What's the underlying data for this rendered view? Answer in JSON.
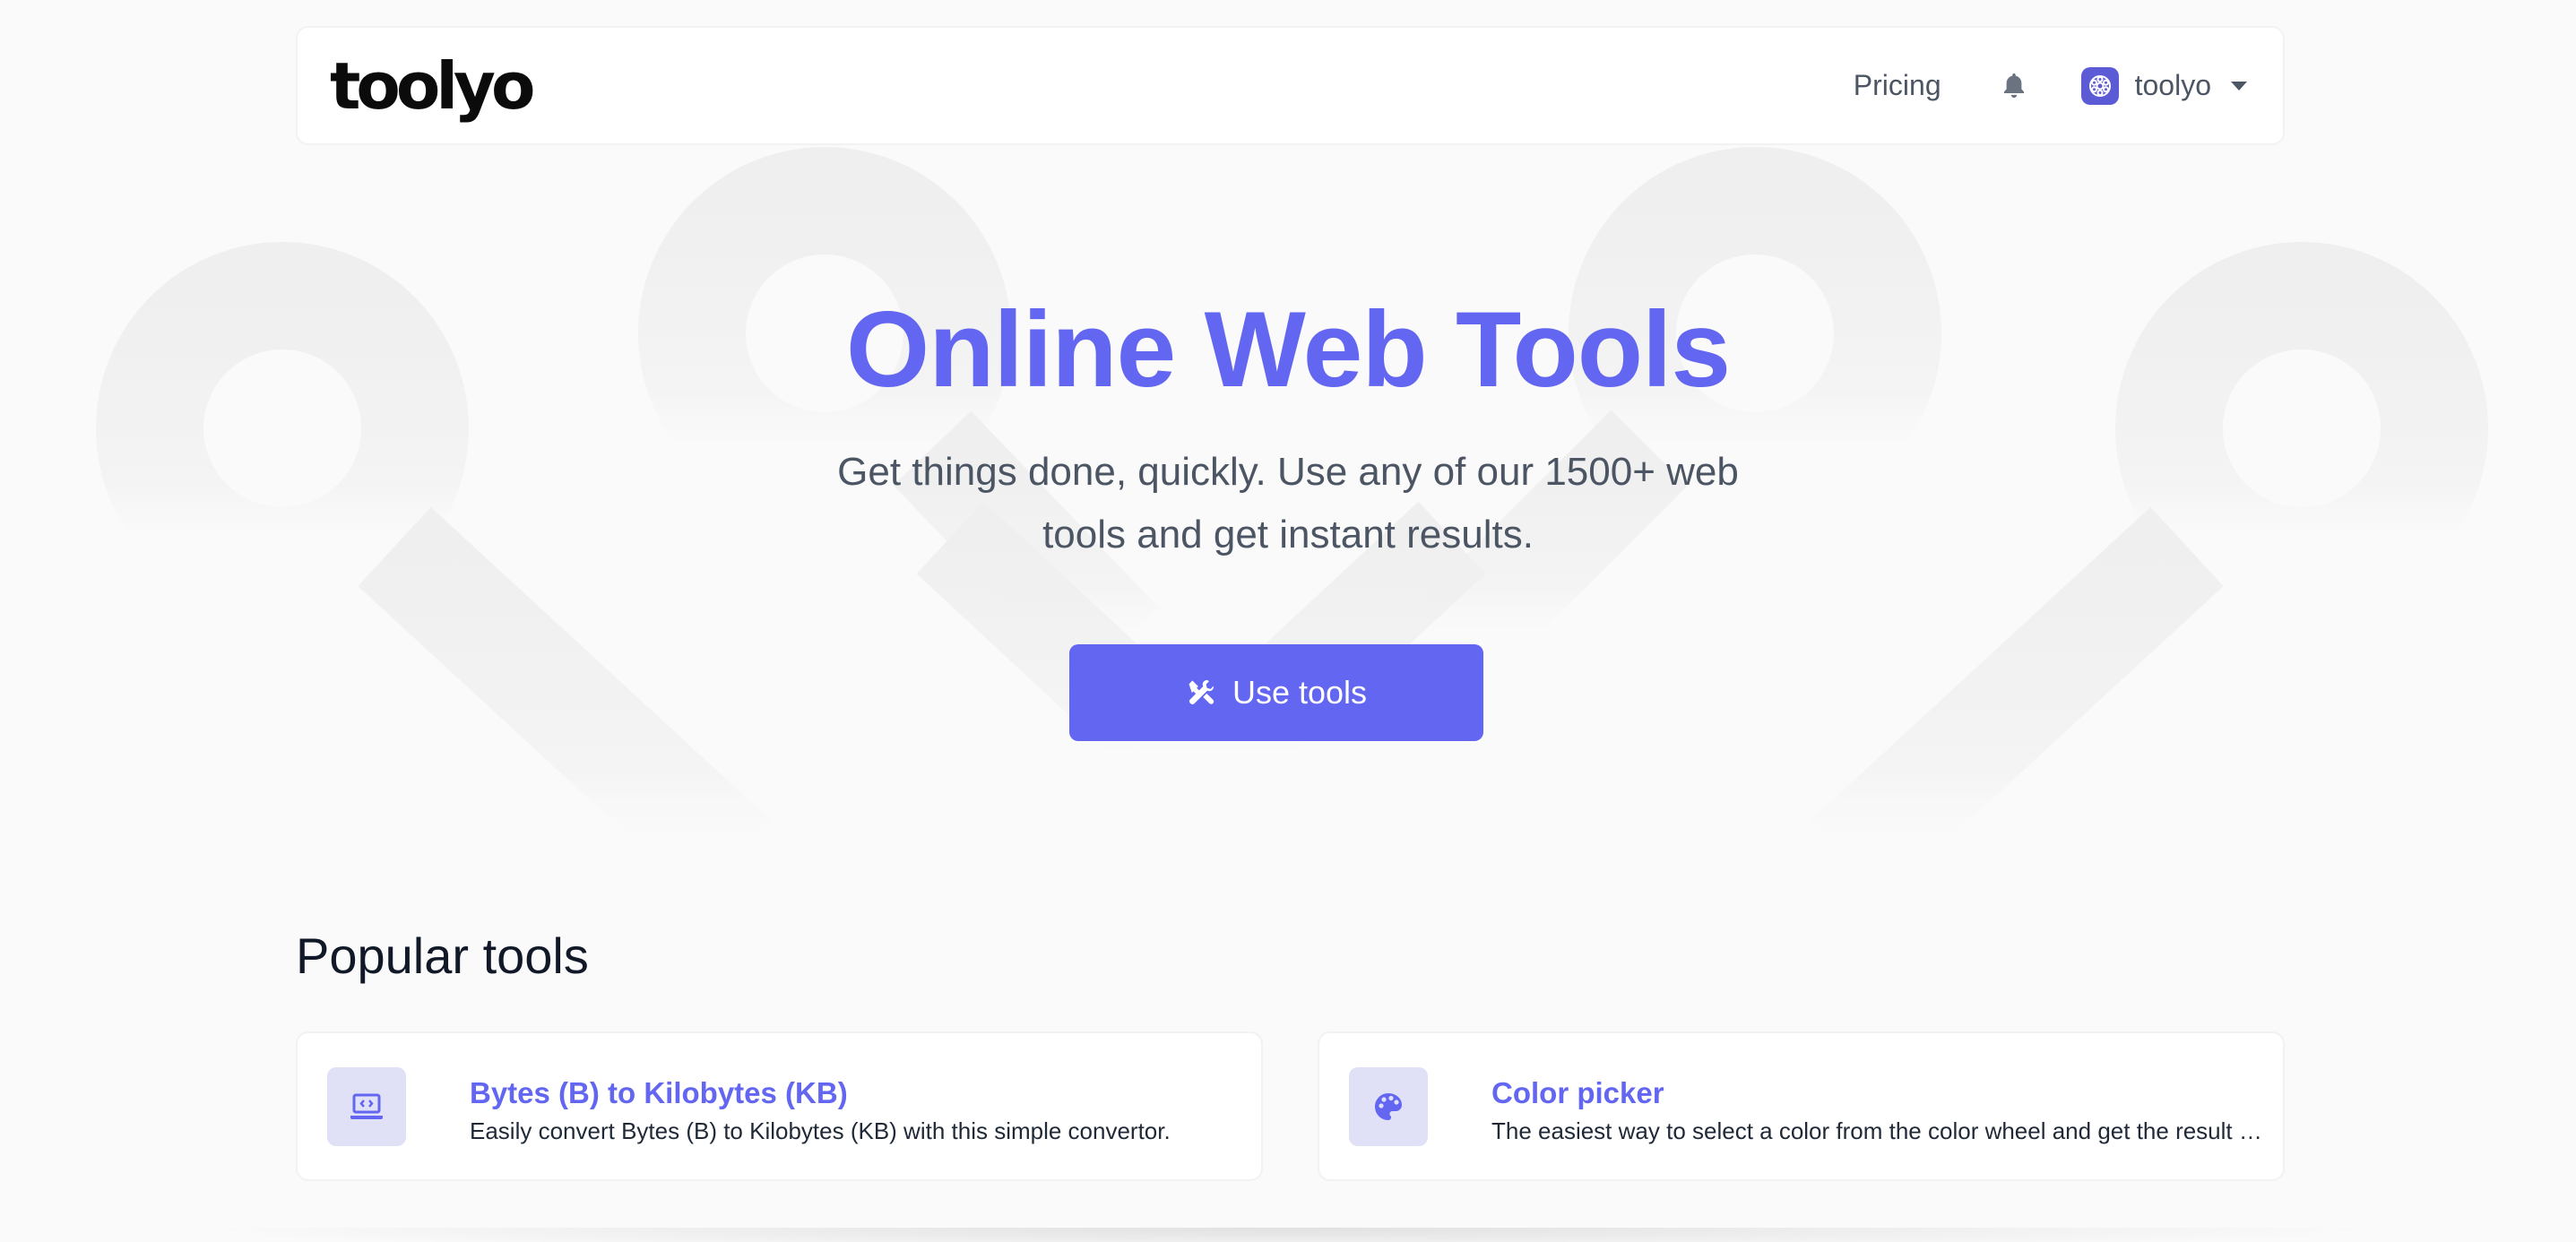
{
  "navbar": {
    "logo": "toolyo",
    "pricing_label": "Pricing",
    "bell_icon": "bell-icon",
    "username": "toolyo"
  },
  "hero": {
    "title": "Online Web Tools",
    "subtitle": "Get things done, quickly. Use any of our 1500+ web tools and get instant results.",
    "cta_label": "Use tools",
    "cta_icon": "tools-icon"
  },
  "popular": {
    "title": "Popular tools",
    "cards": [
      {
        "title": "Bytes (B) to Kilobytes (KB)",
        "description": "Easily convert Bytes (B) to Kilobytes (KB) with this simple convertor.",
        "icon": "laptop-code-icon"
      },
      {
        "title": "Color picker",
        "description": "The easiest way to select a color from the color wheel and get the result in any color format.",
        "icon": "palette-icon"
      }
    ]
  },
  "colors": {
    "accent": "#6366f1",
    "icon_bg": "#e0e1f7",
    "background": "#fafafa",
    "text_muted": "#4b5563"
  }
}
